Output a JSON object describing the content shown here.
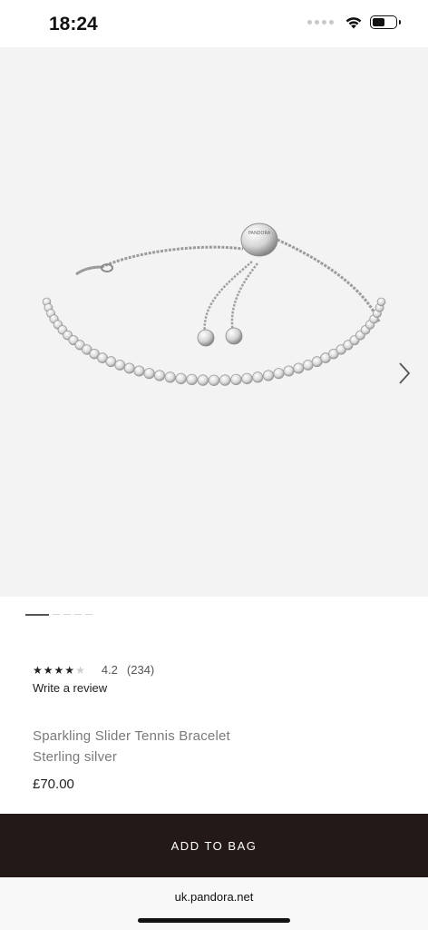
{
  "status_bar": {
    "time": "18:24",
    "icons": [
      "signal-dots-icon",
      "wifi-icon",
      "battery-icon"
    ],
    "battery_level": 0.55
  },
  "gallery": {
    "image": "sterling-silver-slider-tennis-bracelet-image",
    "clasp_engraving": "PANDORA",
    "next_icon": "chevron-right-icon",
    "pager": {
      "total": 5,
      "active": 1
    },
    "background_color": "#f3f3f3"
  },
  "rating": {
    "stars_filled": 4,
    "stars_total": 5,
    "value": "4.2",
    "count": "(234)",
    "write_review": "Write a review"
  },
  "product": {
    "name": "Sparkling Slider Tennis Bracelet",
    "material": "Sterling silver",
    "price": "£70.00"
  },
  "cta": {
    "add_to_bag": "ADD TO BAG",
    "color": "#231a17"
  },
  "browser": {
    "url": "uk.pandora.net"
  }
}
